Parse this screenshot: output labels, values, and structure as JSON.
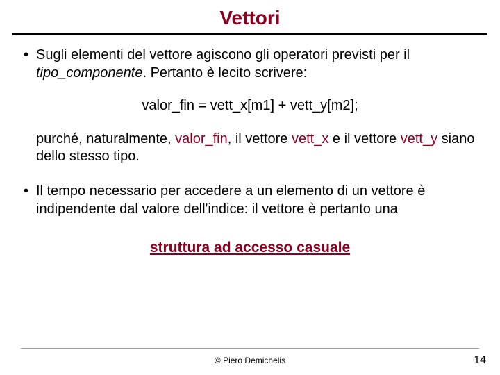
{
  "title": "Vettori",
  "bullet1_a": "Sugli elementi del vettore agiscono gli operatori previsti per il ",
  "bullet1_b": "tipo_componente",
  "bullet1_c": ". Pertanto è lecito scrivere:",
  "code": "valor_fin = vett_x[m1] + vett_y[m2];",
  "follow_a": "purché, naturalmente, ",
  "follow_b": "valor_fin",
  "follow_c": ", il vettore ",
  "follow_d": "vett_x",
  "follow_e": " e il vettore ",
  "follow_f": "vett_y",
  "follow_g": " siano dello stesso tipo.",
  "bullet2": "Il tempo necessario per accedere a un elemento di un vettore è indipendente dal valore dell'indice: il vettore è pertanto una",
  "highlight": "struttura ad accesso casuale",
  "copyright": "© Piero Demichelis",
  "page": "14"
}
